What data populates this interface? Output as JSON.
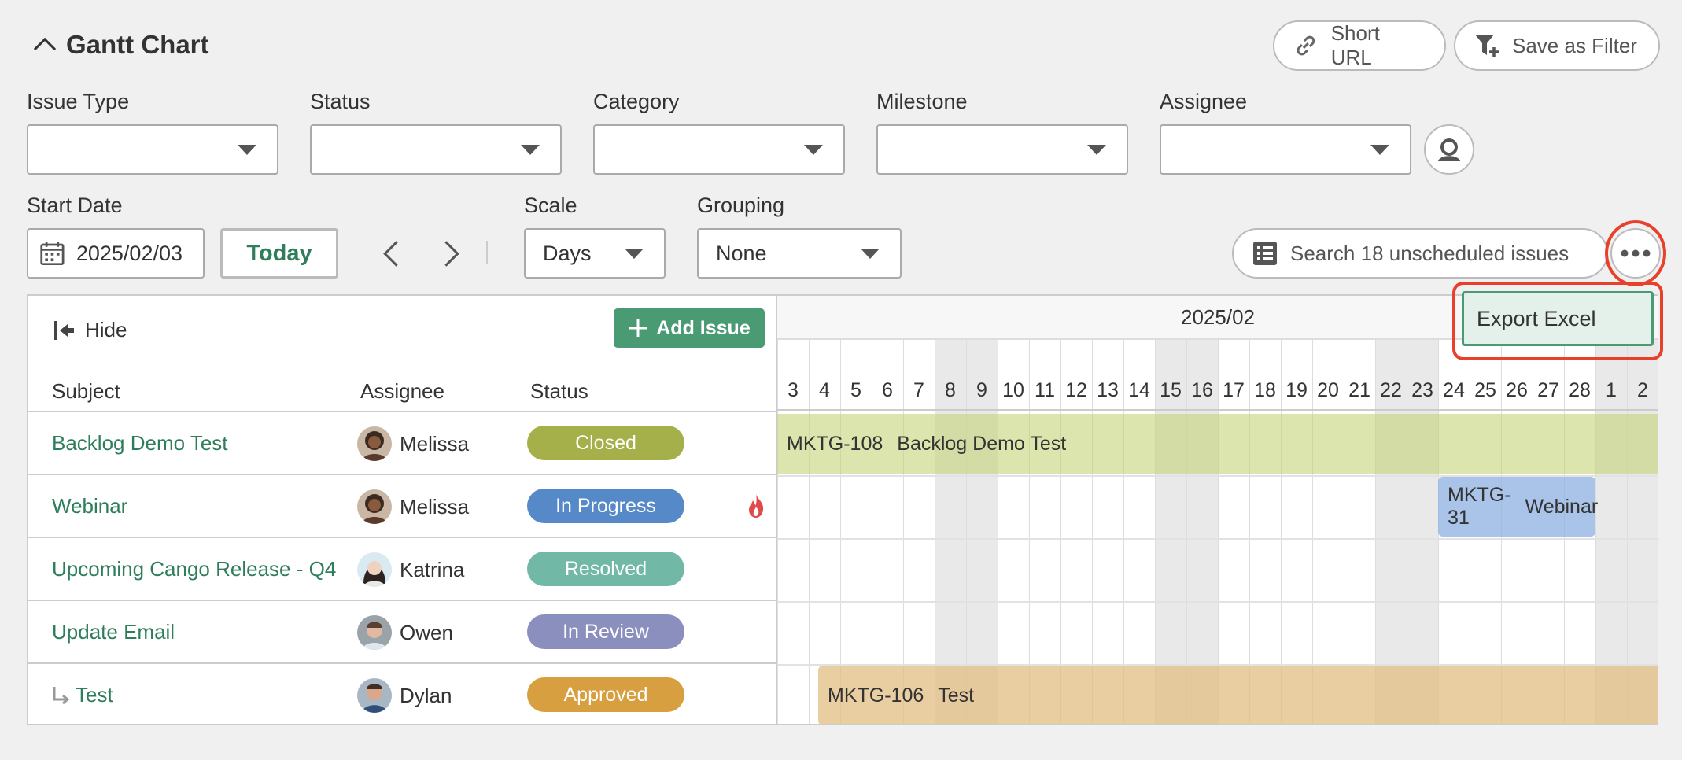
{
  "header": {
    "title": "Gantt Chart",
    "short_url": "Short URL",
    "save_filter": "Save as Filter"
  },
  "filters": {
    "issue_type": {
      "label": "Issue Type",
      "value": ""
    },
    "status": {
      "label": "Status",
      "value": ""
    },
    "category": {
      "label": "Category",
      "value": ""
    },
    "milestone": {
      "label": "Milestone",
      "value": ""
    },
    "assignee": {
      "label": "Assignee",
      "value": ""
    }
  },
  "controls": {
    "start_date_label": "Start Date",
    "start_date": "2025/02/03",
    "today": "Today",
    "scale_label": "Scale",
    "scale": "Days",
    "grouping_label": "Grouping",
    "grouping": "None",
    "unscheduled": "Search 18 unscheduled issues"
  },
  "menu": {
    "export_excel": "Export Excel"
  },
  "list": {
    "hide": "Hide",
    "add_issue": "Add Issue",
    "columns": {
      "subject": "Subject",
      "assignee": "Assignee",
      "status": "Status"
    },
    "rows": [
      {
        "subject": "Backlog Demo Test",
        "assignee": "Melissa",
        "status": "Closed",
        "status_color": "#a5b04a"
      },
      {
        "subject": "Webinar",
        "assignee": "Melissa",
        "status": "In Progress",
        "status_color": "#5689c8"
      },
      {
        "subject": "Upcoming Cango Release - Q4",
        "assignee": "Katrina",
        "status": "Resolved",
        "status_color": "#72b8a6"
      },
      {
        "subject": "Update Email",
        "assignee": "Owen",
        "status": "In Review",
        "status_color": "#8a8fbd"
      },
      {
        "subject": "Test",
        "assignee": "Dylan",
        "status": "Approved",
        "status_color": "#d79f3f"
      }
    ]
  },
  "gantt": {
    "month": "2025/02",
    "days": [
      "3",
      "4",
      "5",
      "6",
      "7",
      "8",
      "9",
      "10",
      "11",
      "12",
      "13",
      "14",
      "15",
      "16",
      "17",
      "18",
      "19",
      "20",
      "21",
      "22",
      "23",
      "24",
      "25",
      "26",
      "27",
      "28",
      "1",
      "2"
    ],
    "weekend_days": [
      5,
      6,
      12,
      13,
      19,
      20,
      26,
      27
    ],
    "bars": [
      {
        "code": "MKTG-108",
        "title": "Backlog Demo Test"
      },
      {
        "code": "MKTG-31",
        "title": "Webinar"
      },
      {
        "code": "MKTG-106",
        "title": "Test"
      }
    ]
  },
  "colors": {
    "accent": "#4a9a74",
    "highlight": "#e8412b"
  }
}
